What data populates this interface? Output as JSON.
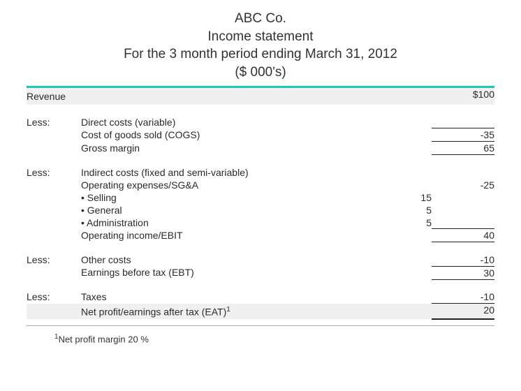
{
  "header": {
    "company": "ABC Co.",
    "title": "Income statement",
    "period": "For the 3 month period ending March 31, 2012",
    "units": "($ 000's)"
  },
  "rows": {
    "revenue_label": "Revenue",
    "revenue_value": "$100",
    "less": "Less:",
    "direct_costs": "Direct costs (variable)",
    "cogs": "Cost of goods sold (COGS)",
    "cogs_val": "-35",
    "gross_margin": "Gross margin",
    "gross_margin_val": "65",
    "indirect_costs": "Indirect costs (fixed and semi-variable)",
    "opex": "Operating expenses/SG&A",
    "opex_val": "-25",
    "selling": "Selling",
    "selling_val": "15",
    "general": "General",
    "general_val": "5",
    "admin": "Administration",
    "admin_val": "5",
    "ebit": "Operating income/EBIT",
    "ebit_val": "40",
    "other_costs": "Other costs",
    "other_costs_val": "-10",
    "ebt": "Earnings before tax (EBT)",
    "ebt_val": "30",
    "taxes": "Taxes",
    "taxes_val": "-10",
    "eat": "Net profit/earnings after tax (EAT)",
    "eat_sup": "1",
    "eat_val": "20"
  },
  "footnote": {
    "sup": "1",
    "text": "Net profit margin 20 %"
  }
}
